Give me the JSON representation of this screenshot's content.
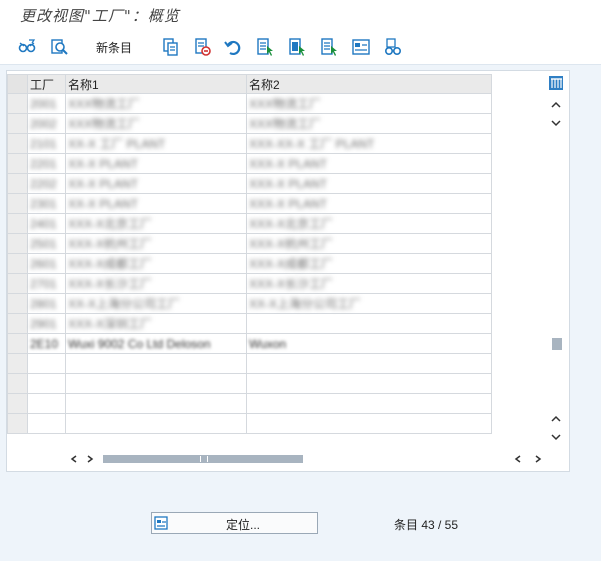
{
  "title": "更改视图\"工厂\"：概览",
  "toolbar": {
    "new_entries_label": "新条目",
    "icons": [
      "display-change-icon",
      "select-all-icon",
      "copy-icon",
      "delete-icon",
      "undo-icon",
      "select-block-icon",
      "select-all-entries-icon",
      "deselect-all-icon",
      "config-icon",
      "glasses-icon"
    ]
  },
  "table": {
    "columns": [
      "工厂",
      "名称1",
      "名称2"
    ],
    "rows": [
      {
        "plant": "2001",
        "name1": "XXX物流工厂",
        "name2": "XXX物流工厂"
      },
      {
        "plant": "2002",
        "name1": "XXX物流工厂",
        "name2": "XXX物流工厂"
      },
      {
        "plant": "2101",
        "name1": "XX-X 工厂 PLANT",
        "name2": "XXX-XX-X 工厂 PLANT"
      },
      {
        "plant": "2201",
        "name1": "XX-X PLANT",
        "name2": "XXX-X PLANT"
      },
      {
        "plant": "2202",
        "name1": "XX-X PLANT",
        "name2": "XXX-X PLANT"
      },
      {
        "plant": "2301",
        "name1": "XX-X PLANT",
        "name2": "XXX-X PLANT"
      },
      {
        "plant": "2401",
        "name1": "XXX-X北京工厂",
        "name2": "XXX-X北京工厂"
      },
      {
        "plant": "2501",
        "name1": "XXX-X杭州工厂",
        "name2": "XXX-X杭州工厂"
      },
      {
        "plant": "2601",
        "name1": "XXX-X成都工厂",
        "name2": "XXX-X成都工厂"
      },
      {
        "plant": "2701",
        "name1": "XXX-X长沙工厂",
        "name2": "XXX-X长沙工厂"
      },
      {
        "plant": "2801",
        "name1": "XX-X上海分公司工厂",
        "name2": "XX-X上海分公司工厂"
      },
      {
        "plant": "2901",
        "name1": "XXX-X深圳工厂",
        "name2": ""
      },
      {
        "plant": "2E10",
        "name1": "Wuxi 9002 Co Ltd Deloson",
        "name2": "Wuxon"
      },
      {
        "plant": "",
        "name1": "",
        "name2": ""
      },
      {
        "plant": "",
        "name1": "",
        "name2": ""
      },
      {
        "plant": "",
        "name1": "",
        "name2": ""
      },
      {
        "plant": "",
        "name1": "",
        "name2": ""
      }
    ]
  },
  "position_button_label": "定位...",
  "entry_count": "条目 43 / 55",
  "colors": {
    "accent": "#1f78c1",
    "green": "#1a8f3c",
    "background": "#eef4fa"
  }
}
